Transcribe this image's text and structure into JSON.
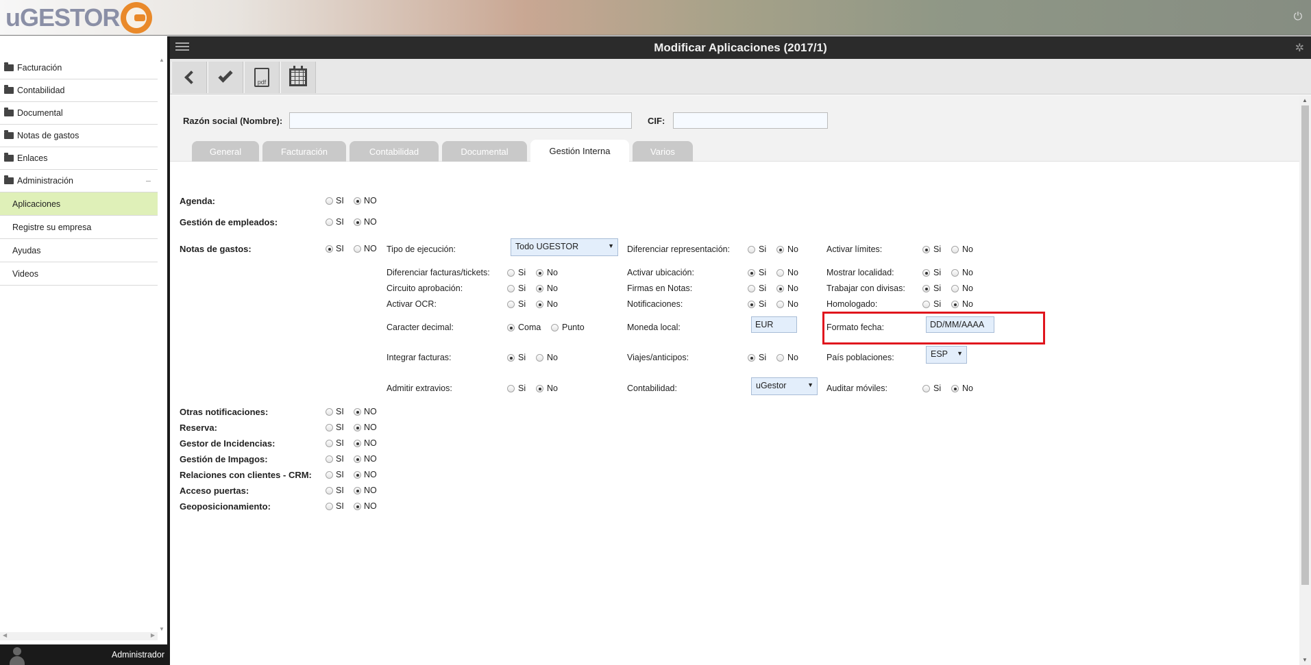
{
  "app": {
    "logo": "uGESTOR",
    "page_title": "Modificar Aplicaciones (2017/1)",
    "user": "Administrador"
  },
  "sidebar": {
    "menus": [
      {
        "label": "Facturación"
      },
      {
        "label": "Contabilidad"
      },
      {
        "label": "Documental"
      },
      {
        "label": "Notas de gastos"
      },
      {
        "label": "Enlaces"
      },
      {
        "label": "Administración",
        "toggle": "–"
      }
    ],
    "subitems": [
      {
        "label": "Aplicaciones",
        "active": true
      },
      {
        "label": "Registre su empresa"
      },
      {
        "label": "Ayudas"
      },
      {
        "label": "Videos"
      }
    ]
  },
  "toolbar": {
    "pdf_label": "pdf"
  },
  "header": {
    "razon_label": "Razón social (Nombre):",
    "razon_value": "",
    "cif_label": "CIF:",
    "cif_value": ""
  },
  "tabs": [
    {
      "label": "General"
    },
    {
      "label": "Facturación"
    },
    {
      "label": "Contabilidad"
    },
    {
      "label": "Documental"
    },
    {
      "label": "Gestión Interna",
      "active": true
    },
    {
      "label": "Varios"
    }
  ],
  "form": {
    "si_upper": "SI",
    "no_upper": "NO",
    "si": "Si",
    "no": "No",
    "agenda": {
      "label": "Agenda:",
      "value": "NO"
    },
    "empleados": {
      "label": "Gestión de empleados:",
      "value": "NO"
    },
    "notas": {
      "label": "Notas de gastos:",
      "value": "SI"
    },
    "tipo_ejecucion": {
      "label": "Tipo de ejecución:",
      "value": "Todo UGESTOR"
    },
    "dif_representacion": {
      "label": "Diferenciar representación:",
      "value": "No"
    },
    "activar_limites": {
      "label": "Activar límites:",
      "value": "Si"
    },
    "dif_facturas": {
      "label": "Diferenciar facturas/tickets:",
      "value": "No"
    },
    "activar_ubicacion": {
      "label": "Activar ubicación:",
      "value": "Si"
    },
    "mostrar_localidad": {
      "label": "Mostrar localidad:",
      "value": "Si"
    },
    "circuito": {
      "label": "Circuito aprobación:",
      "value": "No"
    },
    "firmas": {
      "label": "Firmas en Notas:",
      "value": "No"
    },
    "divisas": {
      "label": "Trabajar con divisas:",
      "value": "Si"
    },
    "ocr": {
      "label": "Activar OCR:",
      "value": "No"
    },
    "notificaciones": {
      "label": "Notificaciones:",
      "value": "Si"
    },
    "homologado": {
      "label": "Homologado:",
      "value": "No"
    },
    "caracter_decimal": {
      "label": "Caracter decimal:",
      "value": "Coma",
      "opt1": "Coma",
      "opt2": "Punto"
    },
    "moneda_local": {
      "label": "Moneda local:",
      "value": "EUR"
    },
    "formato_fecha": {
      "label": "Formato fecha:",
      "value": "DD/MM/AAAA"
    },
    "integrar_facturas": {
      "label": "Integrar facturas:",
      "value": "Si"
    },
    "viajes": {
      "label": "Viajes/anticipos:",
      "value": "Si"
    },
    "pais": {
      "label": "País poblaciones:",
      "value": "ESP"
    },
    "extravios": {
      "label": "Admitir extravios:",
      "value": "No"
    },
    "contabilidad": {
      "label": "Contabilidad:",
      "value": "uGestor"
    },
    "auditar": {
      "label": "Auditar móviles:",
      "value": "No"
    },
    "otras_notif": {
      "label": "Otras notificaciones:",
      "value": "NO"
    },
    "reserva": {
      "label": "Reserva:",
      "value": "NO"
    },
    "incidencias": {
      "label": "Gestor de Incidencias:",
      "value": "NO"
    },
    "impagos": {
      "label": "Gestión de Impagos:",
      "value": "NO"
    },
    "crm": {
      "label": "Relaciones con clientes - CRM:",
      "value": "NO"
    },
    "puertas": {
      "label": "Acceso puertas:",
      "value": "NO"
    },
    "geo": {
      "label": "Geoposicionamiento:",
      "value": "NO"
    }
  },
  "colors": {
    "active_menu_bg": "#dff0b8",
    "titlebar_bg": "#2b2b2b",
    "highlight": "#e0151d",
    "logo_orange": "#e9892a"
  }
}
